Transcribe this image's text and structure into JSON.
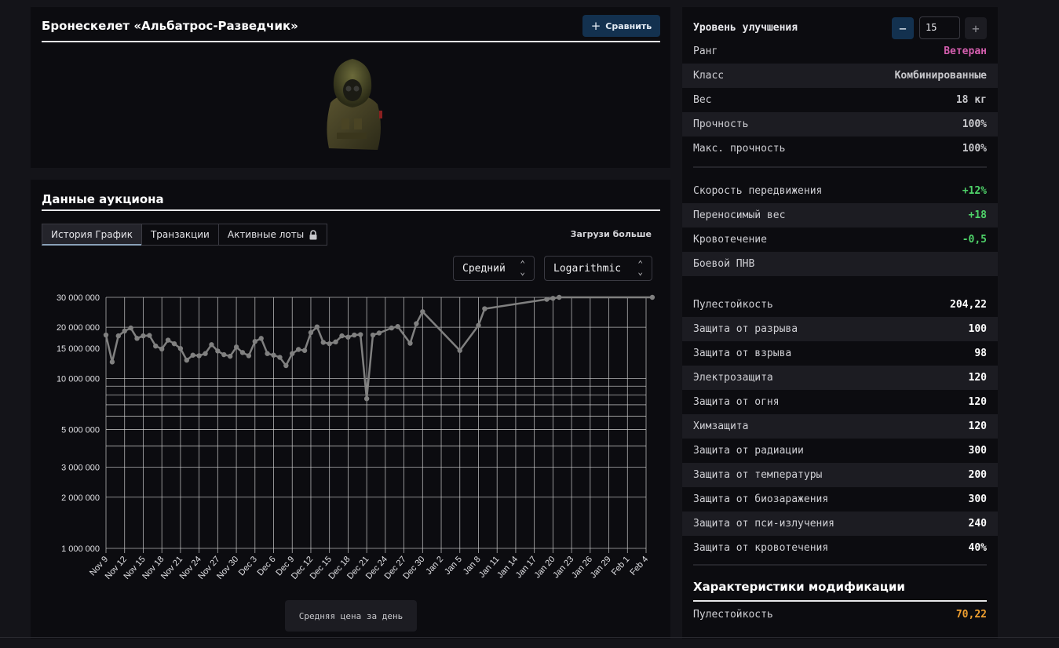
{
  "item": {
    "title": "Бронескелет «Альбатрос-Разведчик»",
    "compare_label": "Сравнить"
  },
  "auction": {
    "title": "Данные аукциона",
    "tabs": [
      {
        "label": "История График",
        "active": true
      },
      {
        "label": "Транзакции",
        "active": false
      },
      {
        "label": "Активные лоты",
        "active": false,
        "locked": true
      }
    ],
    "load_more": "Загрузи больше",
    "price_mode": "Средний",
    "scale_mode": "Logarithmic",
    "legend": "Средняя цена за день"
  },
  "chart_data": {
    "type": "line",
    "scale": "log",
    "grid": true,
    "ylim": [
      1000000,
      30000000
    ],
    "y_tick_labels": [
      "30 000 000",
      "20 000 000",
      "15 000 000",
      "10 000 000",
      "5 000 000",
      "3 000 000",
      "2 000 000",
      "1 000 000"
    ],
    "y_tick_values": [
      30000000,
      20000000,
      15000000,
      10000000,
      5000000,
      3000000,
      2000000,
      1000000
    ],
    "x_tick_labels": [
      "Nov 9",
      "Nov 12",
      "Nov 15",
      "Nov 18",
      "Nov 21",
      "Nov 24",
      "Nov 27",
      "Nov 30",
      "Dec 3",
      "Dec 6",
      "Dec 9",
      "Dec 12",
      "Dec 15",
      "Dec 18",
      "Dec 21",
      "Dec 24",
      "Dec 27",
      "Dec 30",
      "Jan 2",
      "Jan 5",
      "Jan 8",
      "Jan 11",
      "Jan 14",
      "Jan 17",
      "Jan 20",
      "Jan 23",
      "Jan 26",
      "Jan 29",
      "Feb 1",
      "Feb 4"
    ],
    "x_start": "Nov 9",
    "x_end": "Feb 4",
    "line_color": "#808080",
    "x_day_offsets": [
      0,
      1,
      2,
      3,
      4,
      5,
      6,
      7,
      8,
      9,
      10,
      11,
      12,
      13,
      14,
      15,
      16,
      17,
      18,
      19,
      20,
      21,
      22,
      23,
      24,
      25,
      26,
      27,
      28,
      29,
      30,
      31,
      32,
      33,
      34,
      35,
      36,
      37,
      38,
      39,
      40,
      41,
      42,
      43,
      44,
      45,
      46,
      47,
      48,
      49,
      50,
      51,
      52,
      53,
      54,
      55,
      56,
      57,
      58,
      59,
      60,
      61,
      62,
      63,
      64,
      65,
      66,
      67,
      68,
      69,
      70,
      71,
      72,
      73,
      74,
      75,
      76,
      77,
      78,
      79,
      80,
      81,
      82,
      83,
      84,
      85,
      86,
      87,
      88
    ],
    "values": [
      18000000,
      12500000,
      17800000,
      19000000,
      19800000,
      17200000,
      17800000,
      17900000,
      15500000,
      14900000,
      16800000,
      16000000,
      15000000,
      12800000,
      13700000,
      13600000,
      14000000,
      15800000,
      14500000,
      13800000,
      13500000,
      15300000,
      14200000,
      13600000,
      16500000,
      17200000,
      14000000,
      13700000,
      13300000,
      11900000,
      14000000,
      14800000,
      14600000,
      18600000,
      20100000,
      16300000,
      16000000,
      16400000,
      17800000,
      17500000,
      18000000,
      18100000,
      7600000,
      18000000,
      18500000,
      19000000,
      19800000,
      20200000,
      18000000,
      16100000,
      21000000,
      24700000,
      22800000,
      21000000,
      19100000,
      17500000,
      15900000,
      14600000,
      16300000,
      18200000,
      20500000,
      25700000,
      26000000,
      26300000,
      26700000,
      27000000,
      27300000,
      27700000,
      28000000,
      28400000,
      28900000,
      29200000,
      29600000,
      30000000,
      14200000,
      15400000,
      16800000,
      18300000,
      20000000,
      21800000,
      23700000,
      25800000,
      28100000,
      30000000,
      30000000,
      30000000,
      30000000,
      30000000,
      30000000
    ],
    "marker_indices": [
      0,
      1,
      2,
      3,
      4,
      5,
      6,
      7,
      8,
      9,
      10,
      11,
      12,
      13,
      14,
      15,
      16,
      17,
      18,
      19,
      20,
      21,
      22,
      23,
      24,
      25,
      26,
      27,
      28,
      29,
      30,
      31,
      32,
      33,
      34,
      35,
      36,
      37,
      38,
      39,
      40,
      41,
      42,
      43,
      44,
      46,
      47,
      49,
      50,
      51,
      57,
      60,
      61,
      71,
      72,
      73,
      88
    ]
  },
  "stats": {
    "level_label": "Уровень улучшения",
    "level_value": "15",
    "group1": [
      {
        "k": "Ранг",
        "v": "Ветеран",
        "color": "#d65fb0"
      },
      {
        "k": "Класс",
        "v": "Комбинированные",
        "color": "#c8c8cc"
      },
      {
        "k": "Вес",
        "v": "18 кг",
        "color": "#c8c8cc"
      },
      {
        "k": "Прочность",
        "v": "100%",
        "color": "#c8c8cc"
      },
      {
        "k": "Макс. прочность",
        "v": "100%",
        "color": "#c8c8cc"
      }
    ],
    "group2": [
      {
        "k": "Скорость передвижения",
        "v": "+12%",
        "color": "#4fd46a"
      },
      {
        "k": "Переносимый вес",
        "v": "+18",
        "color": "#4fd46a"
      },
      {
        "k": "Кровотечение",
        "v": "-0,5",
        "color": "#4fd46a"
      },
      {
        "k": "Боевой ПНВ",
        "v": "",
        "color": "#c8c8cc"
      }
    ],
    "group3": [
      {
        "k": "Пулестойкость",
        "v": "204,22",
        "color": "#ffffff"
      },
      {
        "k": "Защита от разрыва",
        "v": "100",
        "color": "#ffffff"
      },
      {
        "k": "Защита от взрыва",
        "v": "98",
        "color": "#ffffff"
      },
      {
        "k": "Электрозащита",
        "v": "120",
        "color": "#ffffff"
      },
      {
        "k": "Защита от огня",
        "v": "120",
        "color": "#ffffff"
      },
      {
        "k": "Химзащита",
        "v": "120",
        "color": "#ffffff"
      },
      {
        "k": "Защита от радиации",
        "v": "300",
        "color": "#ffffff"
      },
      {
        "k": "Защита от температуры",
        "v": "200",
        "color": "#ffffff"
      },
      {
        "k": "Защита от биозаражения",
        "v": "300",
        "color": "#ffffff"
      },
      {
        "k": "Защита от пси-излучения",
        "v": "240",
        "color": "#ffffff"
      },
      {
        "k": "Защита от кровотечения",
        "v": "40%",
        "color": "#ffffff"
      }
    ],
    "mod_title": "Характеристики модификации",
    "mod": [
      {
        "k": "Пулестойкость",
        "v": "70,22",
        "color": "#f0a030"
      }
    ]
  }
}
